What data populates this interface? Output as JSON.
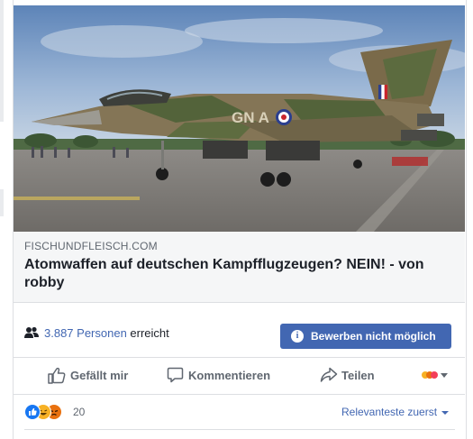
{
  "link_preview": {
    "image_alt": "Eurofighter in camouflage with GN-A marking",
    "aircraft_marking": "GN A",
    "domain": "FISCHUNDFLEISCH.COM",
    "title": "Atomwaffen auf deutschen Kampfflugzeugen? NEIN! - von robby"
  },
  "reach": {
    "count": "3.887 Personen",
    "suffix": " erreicht",
    "boost_button": "Bewerben nicht möglich",
    "boost_info_glyph": "i"
  },
  "actions": {
    "like": "Gefällt mir",
    "comment": "Kommentieren",
    "share": "Teilen"
  },
  "reactions": {
    "count": "20",
    "sort_label": "Relevanteste zuerst"
  },
  "colors": {
    "brand_blue": "#4267b2",
    "like_blue": "#1877f2",
    "haha_yellow": "#f7b125",
    "angry_orange": "#e9710f"
  },
  "icons": [
    "people-icon",
    "info-icon",
    "like-icon",
    "comment-icon",
    "share-icon",
    "reaction-picker-icon",
    "like-reaction-icon",
    "haha-reaction-icon",
    "angry-reaction-icon"
  ]
}
